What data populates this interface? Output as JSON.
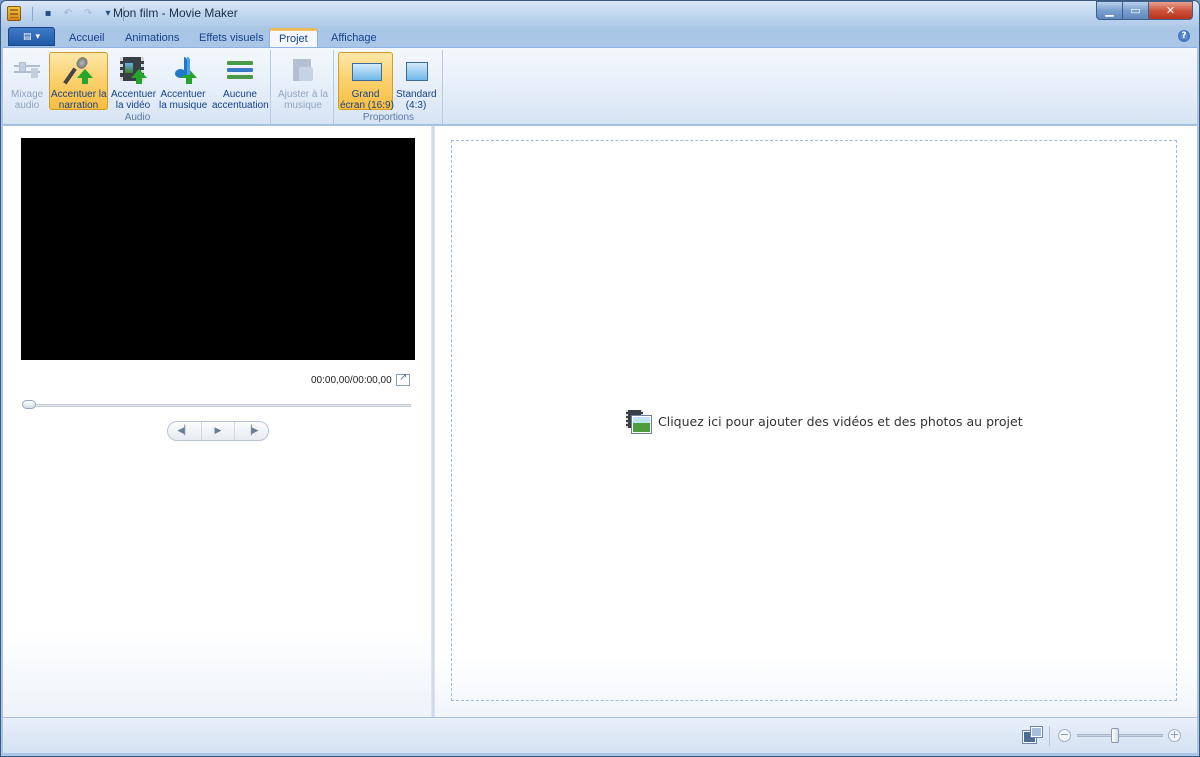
{
  "window": {
    "title": "Mon film - Movie Maker"
  },
  "tabs": [
    {
      "label": "Accueil",
      "active": false
    },
    {
      "label": "Animations",
      "active": false
    },
    {
      "label": "Effets visuels",
      "active": false
    },
    {
      "label": "Projet",
      "active": true
    },
    {
      "label": "Affichage",
      "active": false
    }
  ],
  "ribbon": {
    "audio_group": {
      "label": "Audio",
      "buttons": [
        {
          "line1": "Mixage",
          "line2": "audio",
          "icon": "audio-mix-icon",
          "enabled": false
        },
        {
          "line1": "Accentuer la",
          "line2": "narration",
          "icon": "microphone-icon",
          "selected": true
        },
        {
          "line1": "Accentuer",
          "line2": "la vidéo",
          "icon": "film-icon"
        },
        {
          "line1": "Accentuer",
          "line2": "la musique",
          "icon": "music-note-icon"
        },
        {
          "line1": "Aucune",
          "line2": "accentuation",
          "icon": "equal-lines-icon"
        }
      ]
    },
    "fit_group": {
      "buttons": [
        {
          "line1": "Ajuster à la",
          "line2": "musique",
          "icon": "fit-to-music-icon",
          "enabled": false
        }
      ]
    },
    "ratio_group": {
      "label": "Proportions",
      "buttons": [
        {
          "line1": "Grand",
          "line2": "écran (16:9)",
          "icon": "widescreen-icon",
          "selected": true
        },
        {
          "line1": "Standard",
          "line2": "(4:3)",
          "icon": "standard-screen-icon"
        }
      ]
    }
  },
  "preview": {
    "time": "00:00,00/00:00,00"
  },
  "storyboard": {
    "drop_message": "Cliquez ici pour ajouter des vidéos et des photos au projet"
  },
  "colors": {
    "accent_selected": "#f8be3f",
    "tab_text": "#15428b",
    "frame": "#a9c6e6"
  }
}
